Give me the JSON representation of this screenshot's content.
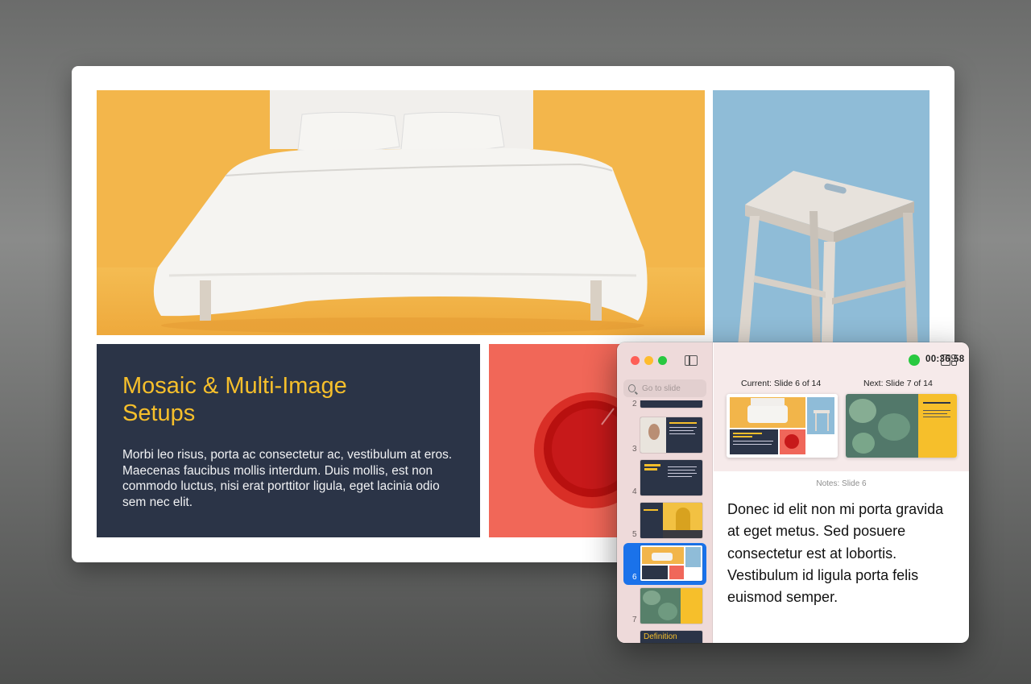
{
  "slide": {
    "title": "Mosaic & Multi-Image Setups",
    "body": "Morbi leo risus, porta ac consectetur ac, vestibulum at eros. Maecenas faucibus mollis interdum. Duis mollis, est non commodo luctus, nisi erat porttitor ligula, eget lacinia odio sem nec elit."
  },
  "presenter": {
    "search_placeholder": "Go to slide",
    "timer": "00:36:58",
    "current_label": "Current: Slide 6 of 14",
    "next_label": "Next: Slide 7 of 14",
    "notes_label": "Notes: Slide 6",
    "notes": "Donec id elit non mi porta gravida at eget metus. Sed posuere consectetur est at lobortis. Vestibulum id ligula porta felis euismod semper.",
    "thumbnails": [
      {
        "num": "2"
      },
      {
        "num": "3"
      },
      {
        "num": "4"
      },
      {
        "num": "5"
      },
      {
        "num": "6"
      },
      {
        "num": "7"
      },
      {
        "num": "",
        "label": "Definition"
      }
    ],
    "selected_slide": "6"
  },
  "colors": {
    "accent": "#f6bf2b",
    "navy": "#2b3447",
    "selection": "#1a72ea",
    "timer_active": "#29c940"
  }
}
